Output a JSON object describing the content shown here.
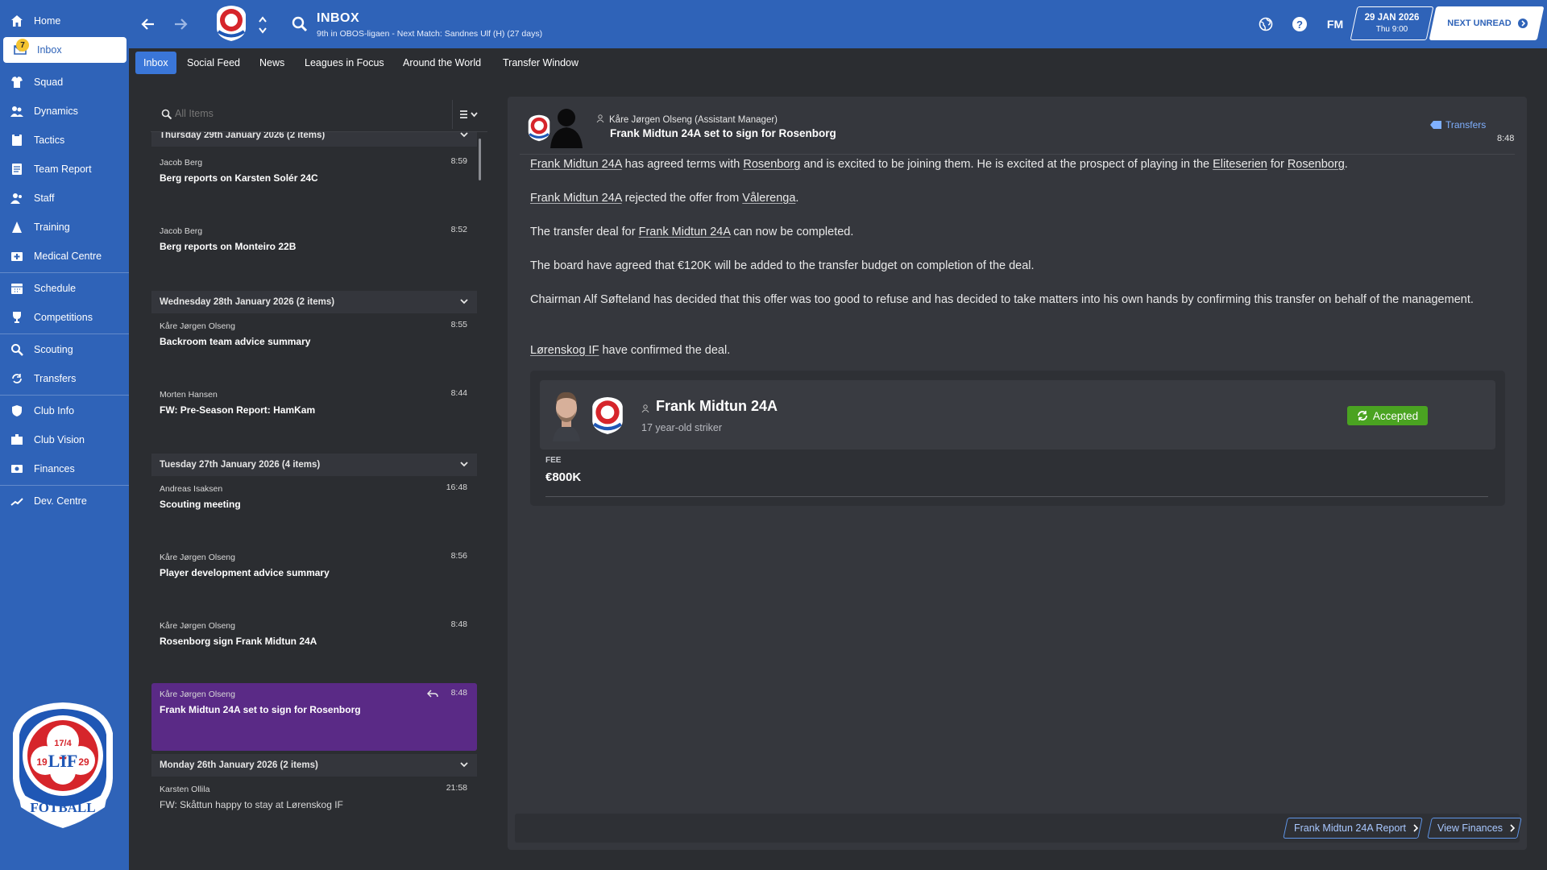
{
  "sidebar": {
    "items": [
      {
        "label": "Home",
        "icon": "home-icon"
      },
      {
        "label": "Inbox",
        "icon": "inbox-icon",
        "badge": "7"
      },
      {
        "label": "Squad",
        "icon": "squad-icon"
      },
      {
        "label": "Dynamics",
        "icon": "dynamics-icon"
      },
      {
        "label": "Tactics",
        "icon": "tactics-icon"
      },
      {
        "label": "Team Report",
        "icon": "report-icon"
      },
      {
        "label": "Staff",
        "icon": "staff-icon"
      },
      {
        "label": "Training",
        "icon": "training-icon"
      },
      {
        "label": "Medical Centre",
        "icon": "medical-icon"
      },
      {
        "label": "Schedule",
        "icon": "calendar-icon"
      },
      {
        "label": "Competitions",
        "icon": "trophy-icon"
      },
      {
        "label": "Scouting",
        "icon": "search-icon"
      },
      {
        "label": "Transfers",
        "icon": "transfer-icon"
      },
      {
        "label": "Club Info",
        "icon": "shield-icon"
      },
      {
        "label": "Club Vision",
        "icon": "vision-icon"
      },
      {
        "label": "Finances",
        "icon": "finances-icon"
      },
      {
        "label": "Dev. Centre",
        "icon": "dev-centre-icon"
      }
    ]
  },
  "header": {
    "title": "INBOX",
    "subtitle": "9th in OBOS-ligaen - Next Match: Sandnes Ulf (H) (27 days)",
    "fm_label": "FM",
    "date_main": "29 JAN 2026",
    "date_sub": "Thu 9:00",
    "next_unread": "NEXT UNREAD"
  },
  "tabs": [
    "Inbox",
    "Social Feed",
    "News",
    "Leagues in Focus",
    "Around the World",
    "Transfer Window"
  ],
  "message_list": {
    "search_placeholder": "All Items",
    "groups": [
      {
        "header": "Thursday 29th January 2026 (2 items)",
        "messages": [
          {
            "sender": "Jacob Berg",
            "time": "8:59",
            "subject": "Berg reports on Karsten Solér 24C"
          },
          {
            "sender": "Jacob Berg",
            "time": "8:52",
            "subject": "Berg reports on Monteiro 22B"
          }
        ]
      },
      {
        "header": "Wednesday 28th January 2026 (2 items)",
        "messages": [
          {
            "sender": "Kåre Jørgen Olseng",
            "time": "8:55",
            "subject": "Backroom team advice summary"
          },
          {
            "sender": "Morten Hansen",
            "time": "8:44",
            "subject": "FW: Pre-Season Report: HamKam"
          }
        ]
      },
      {
        "header": "Tuesday 27th January 2026 (4 items)",
        "messages": [
          {
            "sender": "Andreas Isaksen",
            "time": "16:48",
            "subject": "Scouting meeting"
          },
          {
            "sender": "Kåre Jørgen Olseng",
            "time": "8:56",
            "subject": "Player development advice summary"
          },
          {
            "sender": "Kåre Jørgen Olseng",
            "time": "8:48",
            "subject": "Rosenborg sign Frank Midtun 24A"
          },
          {
            "sender": "Kåre Jørgen Olseng",
            "time": "8:48",
            "subject": "Frank Midtun 24A set to sign for Rosenborg",
            "selected": true
          }
        ]
      },
      {
        "header": "Monday 26th January 2026 (2 items)",
        "messages": [
          {
            "sender": "Karsten Ollila",
            "time": "21:58",
            "subject": "FW: Skåttun happy to stay at Lørenskog IF"
          }
        ]
      }
    ]
  },
  "reader": {
    "from": "Kåre Jørgen Olseng  (Assistant Manager)",
    "subject": "Frank Midtun 24A set to sign for Rosenborg",
    "category": "Transfers",
    "time": "8:48",
    "paragraphs": {
      "p1": {
        "a": "Frank Midtun 24A",
        "b": " has agreed terms with ",
        "c": "Rosenborg",
        "d": " and is excited to be joining them. He is excited at the prospect of playing in the ",
        "e": "Eliteserien",
        "f": " for ",
        "g": "Rosenborg",
        "h": "."
      },
      "p2": {
        "a": "Frank Midtun 24A",
        "b": " rejected the offer from ",
        "c": "Vålerenga",
        "d": "."
      },
      "p3": {
        "a": "The transfer deal for ",
        "b": "Frank Midtun 24A",
        "c": " can now be completed."
      },
      "p4": "The board have agreed that €120K will be added to the transfer budget on completion of the deal.",
      "p5": "Chairman Alf Søfteland has decided that this offer was too good to refuse and has decided to take matters into his own hands by confirming this transfer on behalf of the management.",
      "p6": {
        "a": "Lørenskog IF",
        "b": " have confirmed the deal."
      }
    },
    "card": {
      "player_name": "Frank Midtun 24A",
      "player_desc": "17 year-old striker",
      "status": "Accepted",
      "fee_label": "FEE",
      "fee_value": "€800K"
    },
    "footer": {
      "report_btn": "Frank Midtun 24A Report",
      "finances_btn": "View Finances"
    }
  },
  "colors": {
    "brand_blue": "#2f63b8",
    "tab_active": "#3a76d8",
    "selected_msg": "#5a2a86",
    "accepted_green": "#4aa321",
    "badge_yellow": "#f4c430"
  },
  "club_crest": {
    "top": "17/4",
    "left": "19",
    "right": "29",
    "monogram": "LIF",
    "bottom": "FOTBALL"
  }
}
